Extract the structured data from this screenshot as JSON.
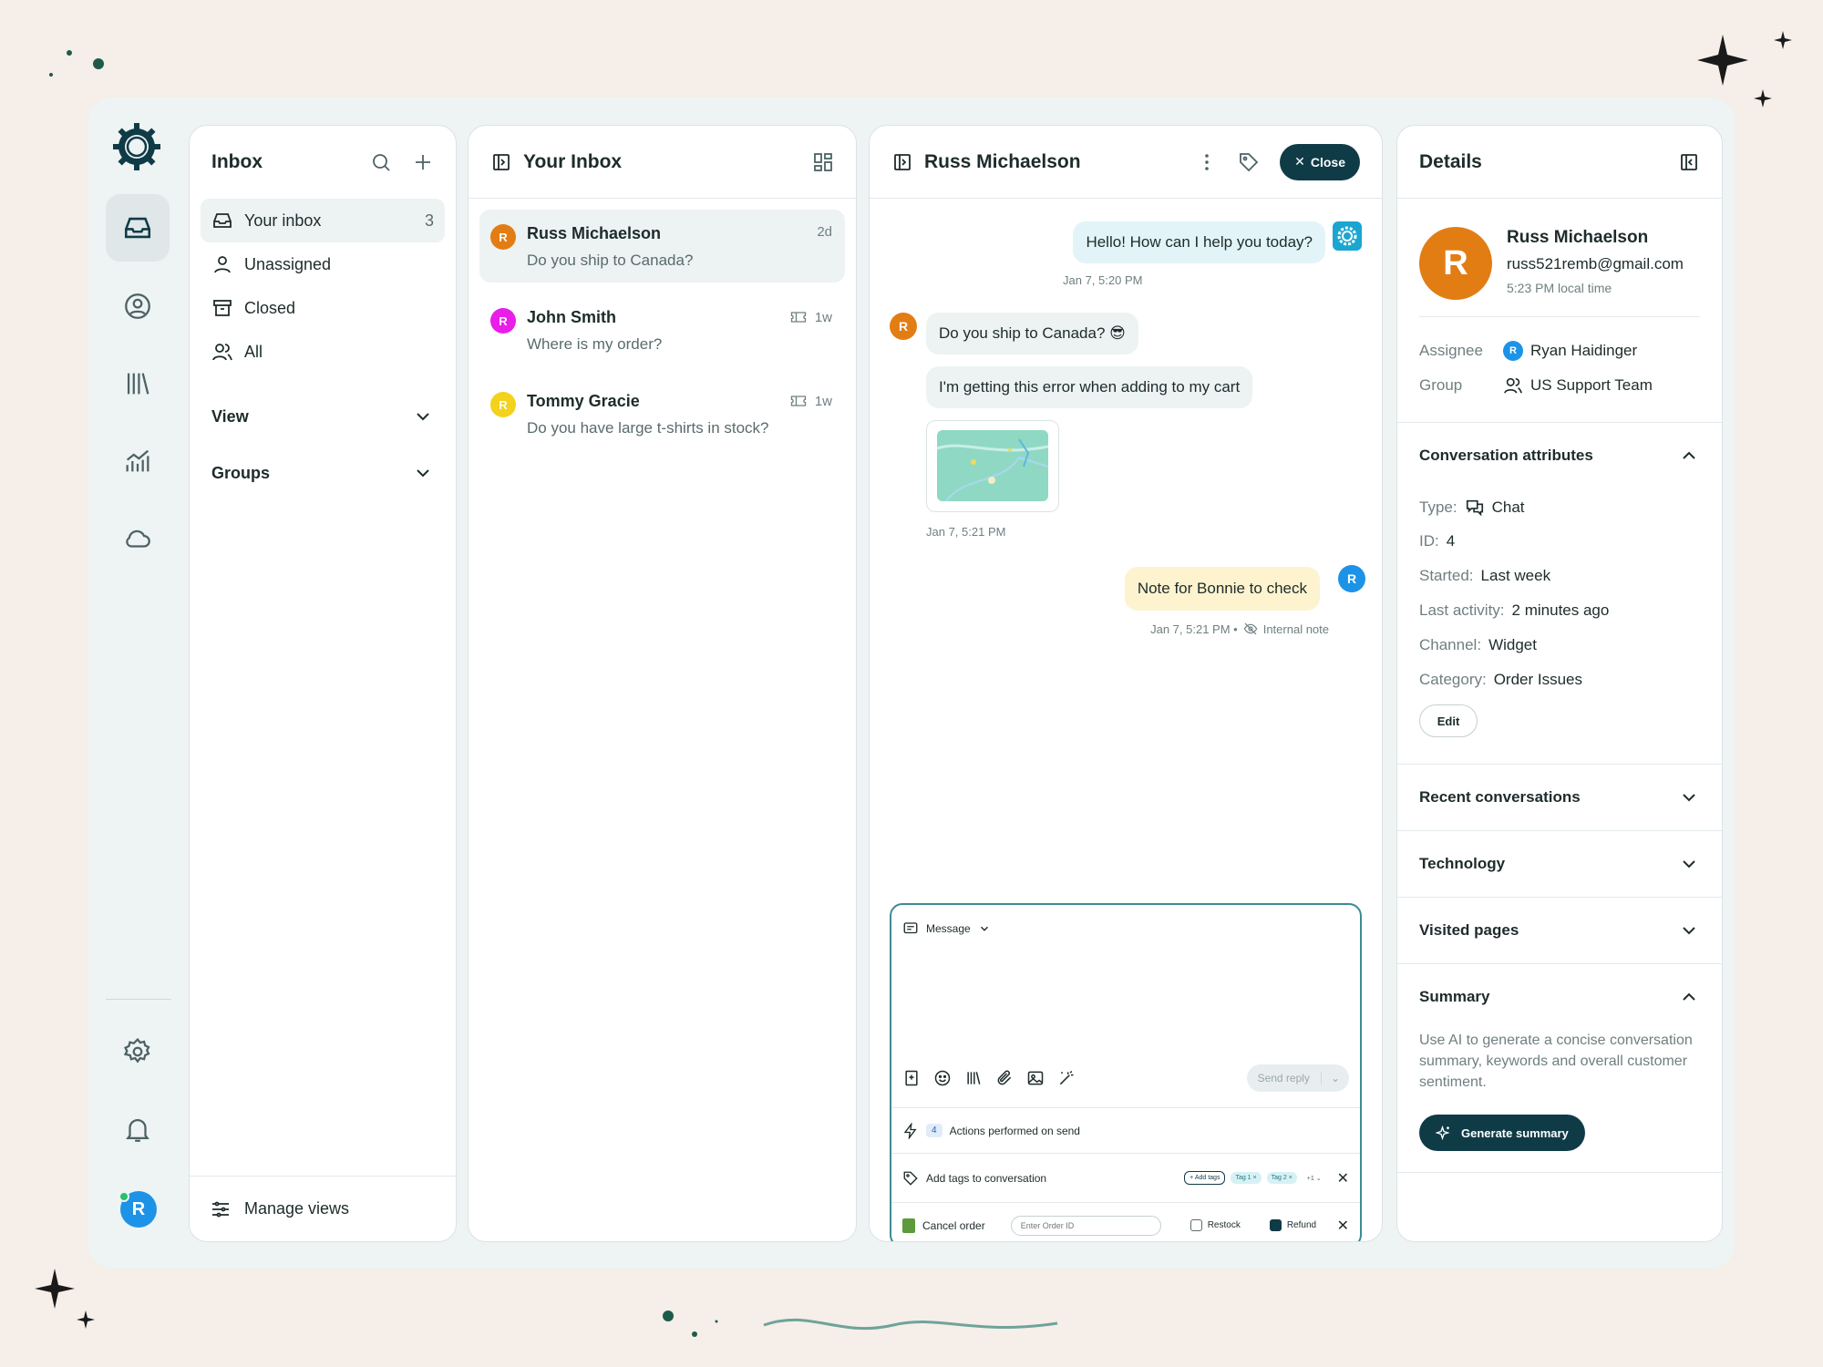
{
  "nav": {
    "title": "Inbox",
    "items": [
      {
        "label": "Your inbox",
        "count": "3"
      },
      {
        "label": "Unassigned"
      },
      {
        "label": "Closed"
      },
      {
        "label": "All"
      }
    ],
    "view_label": "View",
    "groups_label": "Groups",
    "manage_views": "Manage views"
  },
  "rail": {
    "avatar_initial": "R"
  },
  "list": {
    "title": "Your Inbox",
    "conversations": [
      {
        "initial": "R",
        "name": "Russ Michaelson",
        "preview": "Do you ship to Canada?",
        "time": "2d",
        "color": "#e27d14"
      },
      {
        "initial": "R",
        "name": "John Smith",
        "preview": "Where is my order?",
        "time": "1w",
        "color": "#e91ee9"
      },
      {
        "initial": "R",
        "name": "Tommy Gracie",
        "preview": "Do you have large t-shirts in stock?",
        "time": "1w",
        "color": "#f4d21b"
      }
    ]
  },
  "chat": {
    "title": "Russ Michaelson",
    "close_label": "Close",
    "messages": {
      "agent_greeting": "Hello! How can I help you today?",
      "agent_greeting_time": "Jan 7, 5:20 PM",
      "customer_initial": "R",
      "customer_1": "Do you ship to Canada? 😎",
      "customer_2": "I'm getting this error when adding to my cart",
      "customer_time": "Jan 7, 5:21 PM",
      "note": "Note for Bonnie to check",
      "note_initial": "R",
      "note_time": "Jan 7, 5:21 PM •",
      "note_label": "Internal note"
    },
    "composer": {
      "mode": "Message",
      "send_label": "Send reply",
      "actions_count": "4",
      "actions_label": "Actions performed on send",
      "tags_label": "Add tags to conversation",
      "add_tags": "+ Add tags",
      "tag1": "Tag 1 ×",
      "tag2": "Tag 2 ×",
      "more_tags": "+1 ⌄",
      "cancel_order": "Cancel order",
      "order_placeholder": "Enter Order ID",
      "restock": "Restock",
      "refund": "Refund"
    }
  },
  "details": {
    "title": "Details",
    "initial": "R",
    "name": "Russ Michaelson",
    "email": "russ521remb@gmail.com",
    "local_time": "5:23 PM local time",
    "assignee_label": "Assignee",
    "assignee_initial": "R",
    "assignee": "Ryan Haidinger",
    "group_label": "Group",
    "group": "US Support Team",
    "attributes_title": "Conversation attributes",
    "type_label": "Type:",
    "type": "Chat",
    "id_label": "ID:",
    "id": "4",
    "started_label": "Started:",
    "started": "Last week",
    "last_activity_label": "Last activity:",
    "last_activity": "2 minutes ago",
    "channel_label": "Channel:",
    "channel": "Widget",
    "category_label": "Category:",
    "category": "Order Issues",
    "edit_label": "Edit",
    "recent": "Recent conversations",
    "technology": "Technology",
    "visited": "Visited pages",
    "summary_title": "Summary",
    "summary_text": "Use AI to generate a concise conversation summary, keywords and overall customer sentiment.",
    "generate_label": "Generate summary"
  },
  "colors": {
    "accent": "#0f3b47",
    "agent_bubble": "#e2f4f7",
    "note_bubble": "#fdf3cf"
  }
}
